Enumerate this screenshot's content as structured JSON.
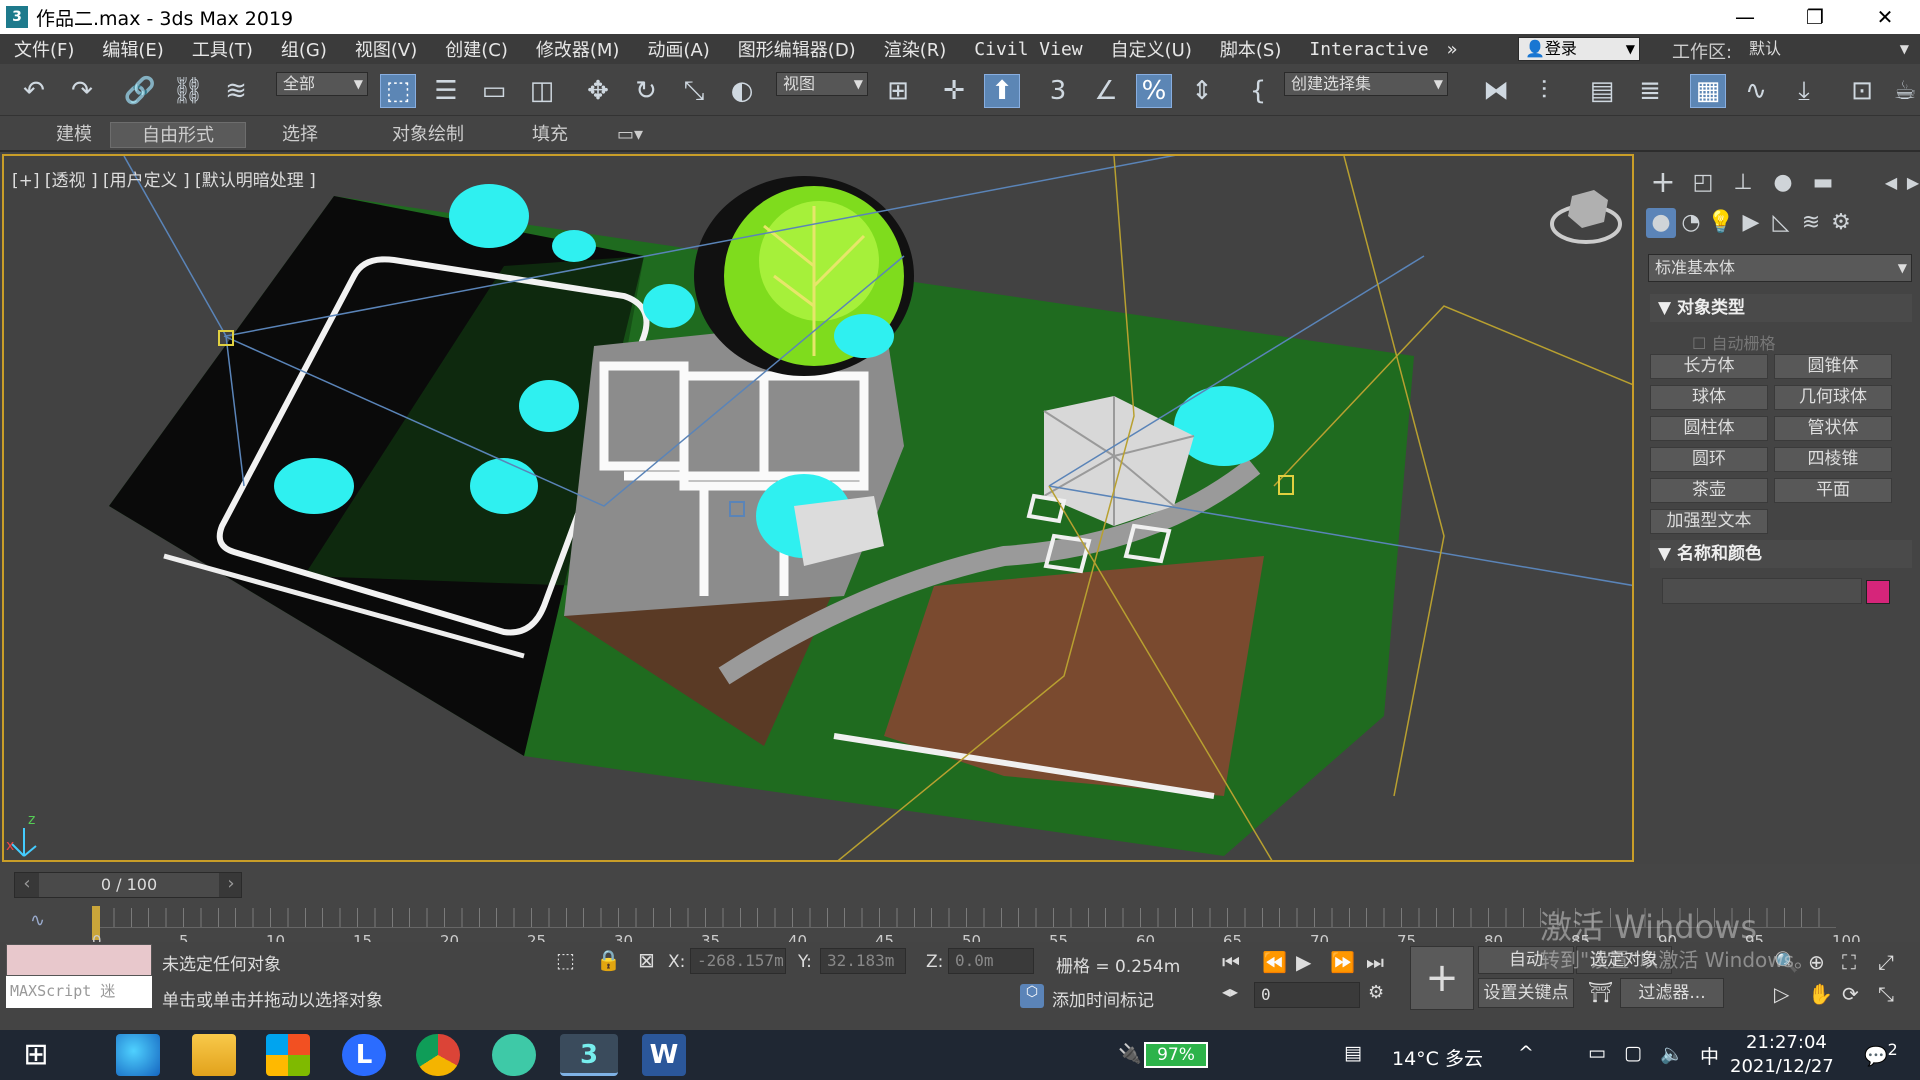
{
  "window": {
    "title": "作品二.max - 3ds Max 2019",
    "app_icon": "3"
  },
  "menu": {
    "items": [
      "文件(F)",
      "编辑(E)",
      "工具(T)",
      "组(G)",
      "视图(V)",
      "创建(C)",
      "修改器(M)",
      "动画(A)",
      "图形编辑器(D)",
      "渲染(R)",
      "Civil View",
      "自定义(U)",
      "脚本(S)",
      "Interactive"
    ],
    "login": "登录",
    "workspace_label": "工作区:",
    "workspace_value": "默认"
  },
  "toolbar": {
    "selection_filter": "全部",
    "ref_coord": "视图",
    "named_selection": "创建选择集"
  },
  "ribbon": {
    "tabs": [
      "建模",
      "自由形式",
      "选择",
      "对象绘制",
      "填充"
    ],
    "selected": "自由形式"
  },
  "viewport": {
    "label": "[+] [透视 ] [用户定义 ] [默认明暗处理 ]"
  },
  "command_panel": {
    "category": "标准基本体",
    "object_type_title": "对象类型",
    "autogrid": "自动栅格",
    "buttons": [
      "长方体",
      "圆锥体",
      "球体",
      "几何球体",
      "圆柱体",
      "管状体",
      "圆环",
      "四棱锥",
      "茶壶",
      "平面",
      "加强型文本"
    ],
    "name_color_title": "名称和颜色",
    "object_color": "#d6257a"
  },
  "timeline": {
    "frame_display": "0 / 100",
    "ticks": [
      "0",
      "5",
      "10",
      "15",
      "20",
      "25",
      "30",
      "35",
      "40",
      "45",
      "50",
      "55",
      "60",
      "65",
      "70",
      "75",
      "80",
      "85",
      "90",
      "95",
      "100"
    ]
  },
  "status": {
    "maxscript": "MAXScript 迷",
    "line1": "未选定任何对象",
    "line2": "单击或单击并拖动以选择对象",
    "x_label": "X:",
    "x_value": "-268.157m",
    "y_label": "Y:",
    "y_value": "32.183m",
    "z_label": "Z:",
    "z_value": "0.0m",
    "grid": "栅格 = 0.254m",
    "add_time_tag": "添加时间标记",
    "auto_key": "自动",
    "selected_objects": "选定对象",
    "set_key": "设置关键点",
    "filters": "过滤器...",
    "current_frame": "0"
  },
  "watermark": {
    "line1": "激活 Windows",
    "line2": "转到\"设置\"以激活 Windows。"
  },
  "taskbar": {
    "battery": "97%",
    "weather": "14°C 多云",
    "ime": "中",
    "time": "21:27:04",
    "date": "2021/12/27",
    "notification_count": "2"
  }
}
